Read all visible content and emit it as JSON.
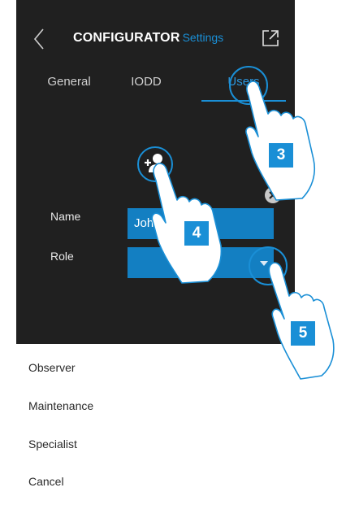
{
  "header": {
    "back_icon": "chevron-left-icon",
    "title_main": "CONFIGURATOR",
    "title_sub": "Settings",
    "export_icon": "external-link-icon"
  },
  "tabs": [
    {
      "label": "General",
      "active": false
    },
    {
      "label": "IODD",
      "active": false
    },
    {
      "label": "Users",
      "active": true
    }
  ],
  "form": {
    "add_user_icon": "add-user-icon",
    "clear_icon": "close-icon",
    "name_label": "Name",
    "name_value": "John",
    "role_label": "Role",
    "role_value": "",
    "role_dropdown_icon": "chevron-down-icon"
  },
  "role_menu": {
    "items": [
      "Observer",
      "Maintenance",
      "Specialist",
      "Cancel"
    ]
  },
  "callouts": [
    {
      "number": "3",
      "target": "Users tab"
    },
    {
      "number": "4",
      "target": "add user button"
    },
    {
      "number": "5",
      "target": "role dropdown"
    }
  ],
  "colors": {
    "accent": "#1a8fd6",
    "field_bg": "#137fc2",
    "dark_bg": "#202020",
    "menu_bg": "#ffffff"
  }
}
